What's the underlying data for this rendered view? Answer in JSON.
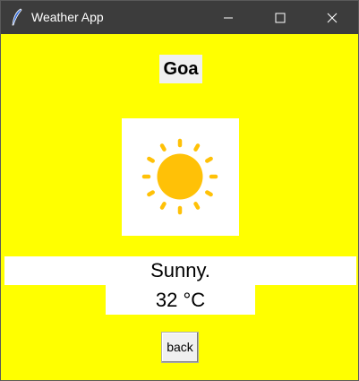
{
  "window": {
    "title": "Weather App",
    "icon": "feather-icon",
    "controls": [
      "minimize-icon",
      "maximize-icon",
      "close-icon"
    ]
  },
  "city": "Goa",
  "weather_icon": "sun-icon",
  "condition": "Sunny.",
  "temperature": "32 °C",
  "back_label": "back",
  "colors": {
    "background": "#ffff00",
    "titlebar": "#3c3c3c",
    "sun": "#ffc107"
  }
}
